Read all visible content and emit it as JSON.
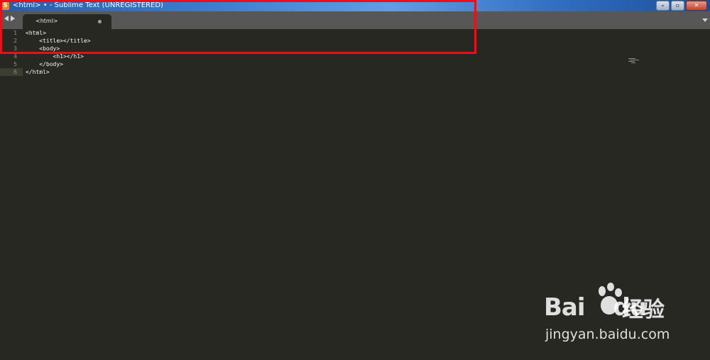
{
  "window": {
    "title": "<html> • - Sublime Text (UNREGISTERED)",
    "controls": {
      "minimize": "–",
      "maximize": "▫",
      "close": "✕"
    }
  },
  "tabs": [
    {
      "label": "<html>",
      "modified": true
    }
  ],
  "editor": {
    "lines": [
      {
        "number": "1",
        "code": "<html>"
      },
      {
        "number": "2",
        "code": "    <title></title>"
      },
      {
        "number": "3",
        "code": "    <body>"
      },
      {
        "number": "4",
        "code": "        <h1></h1>"
      },
      {
        "number": "5",
        "code": "    </body>"
      },
      {
        "number": "6",
        "code": "</html>"
      }
    ],
    "active_line": "6"
  },
  "watermark": {
    "logo": "Bai",
    "logo_suffix": "du",
    "chinese": "经验",
    "url": "jingyan.baidu.com"
  },
  "colors": {
    "editor_bg": "#272822",
    "tabbar_bg": "#575757",
    "annotation": "#e8111b"
  }
}
